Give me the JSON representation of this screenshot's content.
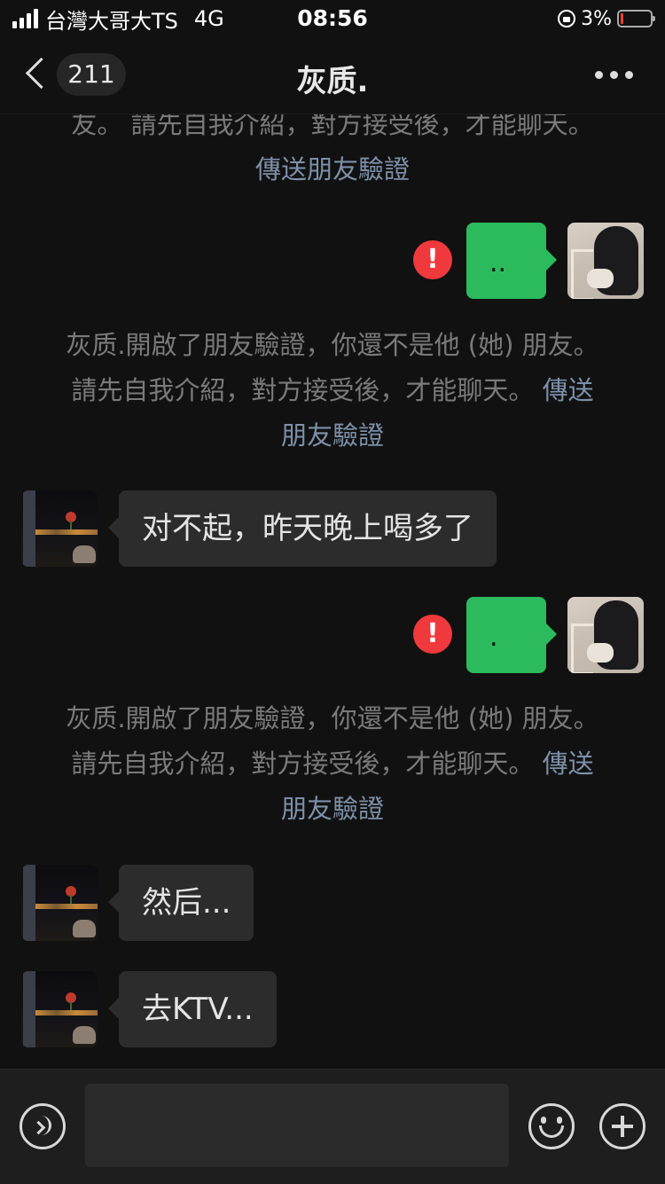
{
  "status_bar": {
    "carrier": "台灣大哥大TS",
    "network": "4G",
    "time": "08:56",
    "battery_percent": "3%",
    "battery_color": "#ff3b30"
  },
  "nav": {
    "back_icon": "chevron-left-icon",
    "unread_count": "211",
    "title": "灰质.",
    "more_icon": "more-dots-icon"
  },
  "system_notice": {
    "partial_text": "友。 請先自我介紹，對方接受後，才能聊天。",
    "text": "灰质.開啟了朋友驗證，你還不是他 (她) 朋友。 請先自我介紹，對方接受後，才能聊天。",
    "link": "傳送朋友驗證"
  },
  "messages": [
    {
      "from": "me",
      "text": "..",
      "status": "failed"
    },
    {
      "from": "system"
    },
    {
      "from": "other",
      "text": "对不起，昨天晚上喝多了"
    },
    {
      "from": "me",
      "text": ".",
      "status": "failed"
    },
    {
      "from": "system"
    },
    {
      "from": "other",
      "text": "然后..."
    },
    {
      "from": "other",
      "text": "去KTV..."
    }
  ],
  "input_bar": {
    "voice_icon": "voice-icon",
    "input_value": "",
    "emoji_icon": "emoji-icon",
    "plus_icon": "plus-icon"
  },
  "colors": {
    "my_bubble": "#2bbb5d",
    "other_bubble": "#2c2c2c",
    "error": "#f0393c",
    "link": "#7d90a9",
    "background": "#111111"
  }
}
